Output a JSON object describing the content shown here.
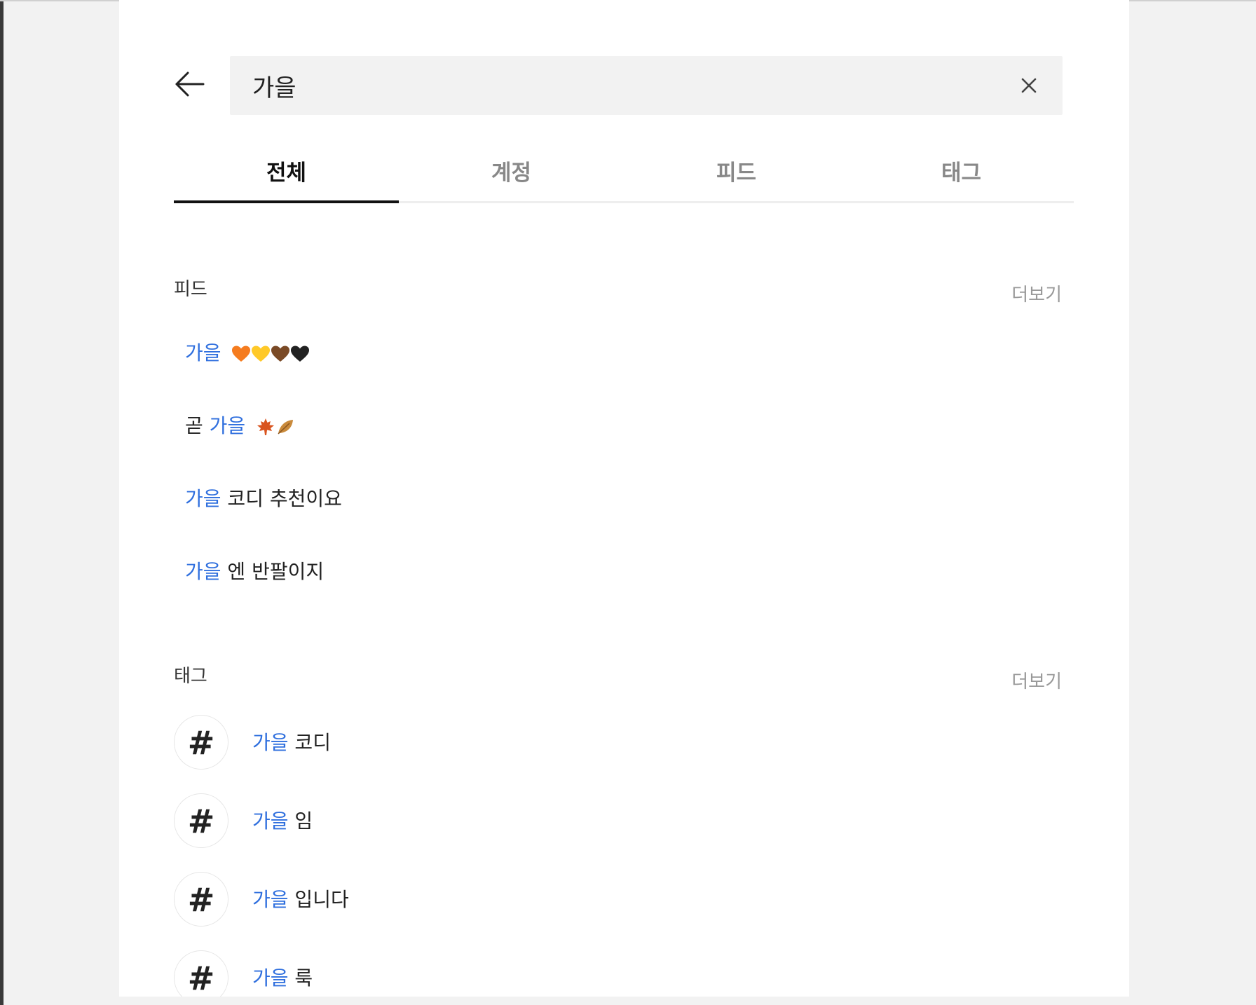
{
  "search": {
    "value": "가을",
    "back_icon": "arrow-left-icon",
    "clear_icon": "close-icon"
  },
  "tabs": [
    {
      "label": "전체",
      "active": true
    },
    {
      "label": "계정",
      "active": false
    },
    {
      "label": "피드",
      "active": false
    },
    {
      "label": "태그",
      "active": false
    }
  ],
  "feed_section": {
    "title": "피드",
    "more": "더보기",
    "items": [
      {
        "prefix": "",
        "highlight": "가을",
        "rest": "",
        "emoji": [
          "orange-heart",
          "yellow-heart",
          "brown-heart",
          "black-heart"
        ]
      },
      {
        "prefix": "곧 ",
        "highlight": "가을",
        "rest": "",
        "emoji": [
          "maple-leaf",
          "fallen-leaf"
        ]
      },
      {
        "prefix": "",
        "highlight": "가을",
        "rest": " 코디 추천이요",
        "emoji": []
      },
      {
        "prefix": "",
        "highlight": "가을",
        "rest": " 엔 반팔이지",
        "emoji": []
      }
    ]
  },
  "tag_section": {
    "title": "태그",
    "more": "더보기",
    "hash_symbol": "#",
    "items": [
      {
        "highlight": "가을",
        "rest": " 코디"
      },
      {
        "highlight": "가을",
        "rest": " 임"
      },
      {
        "highlight": "가을",
        "rest": " 입니다"
      },
      {
        "highlight": "가을",
        "rest": " 룩"
      }
    ]
  },
  "colors": {
    "highlight": "#2f6fde",
    "background": "#f2f2f2",
    "panel": "#ffffff",
    "search_bg": "#f2f2f2"
  }
}
